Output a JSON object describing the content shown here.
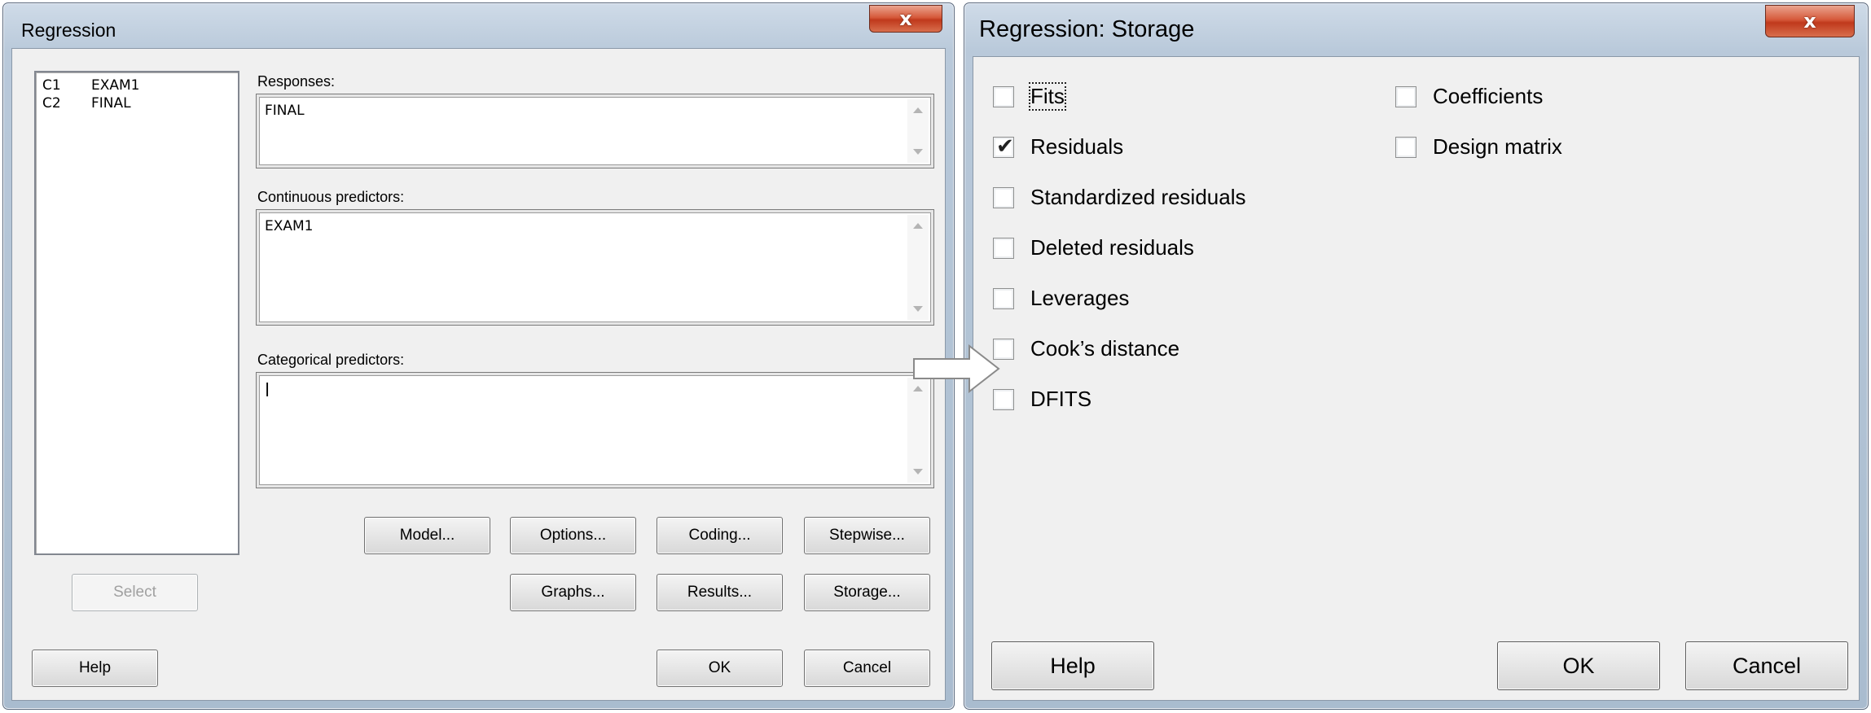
{
  "regression": {
    "title": "Regression",
    "close_glyph": "x",
    "variables": [
      {
        "col": "C1",
        "name": "EXAM1"
      },
      {
        "col": "C2",
        "name": "FINAL"
      }
    ],
    "responses_label": "Responses:",
    "responses_value": "FINAL",
    "continuous_label": "Continuous predictors:",
    "continuous_value": "EXAM1",
    "categorical_label": "Categorical predictors:",
    "categorical_value": "|",
    "buttons": {
      "model": "Model...",
      "options": "Options...",
      "coding": "Coding...",
      "stepwise": "Stepwise...",
      "select": "Select",
      "graphs": "Graphs...",
      "results": "Results...",
      "storage": "Storage...",
      "help": "Help",
      "ok": "OK",
      "cancel": "Cancel"
    }
  },
  "storage": {
    "title": "Regression: Storage",
    "close_glyph": "x",
    "options_left": [
      {
        "label": "Fits",
        "checked": false
      },
      {
        "label": "Residuals",
        "checked": true
      },
      {
        "label": "Standardized residuals",
        "checked": false
      },
      {
        "label": "Deleted residuals",
        "checked": false
      },
      {
        "label": "Leverages",
        "checked": false
      },
      {
        "label": "Cook’s distance",
        "checked": false
      },
      {
        "label": "DFITS",
        "checked": false
      }
    ],
    "options_right": [
      {
        "label": "Coefficients",
        "checked": false
      },
      {
        "label": "Design matrix",
        "checked": false
      }
    ],
    "check_glyph": "✔",
    "buttons": {
      "help": "Help",
      "ok": "OK",
      "cancel": "Cancel"
    }
  }
}
